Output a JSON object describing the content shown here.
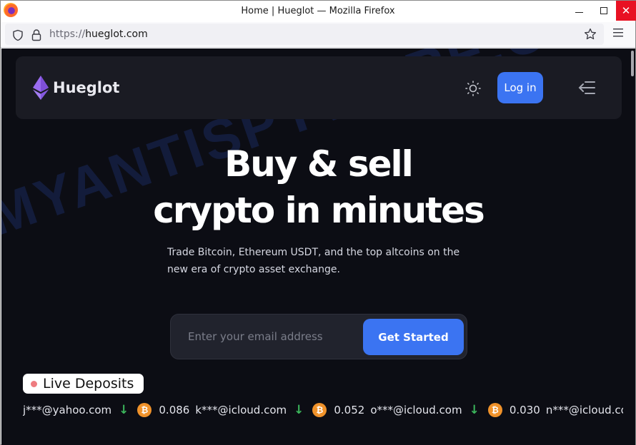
{
  "browser": {
    "window_title": "Home | Hueglot — Mozilla Firefox",
    "url_protocol": "https://",
    "url_host": "hueglot.com",
    "close_glyph": "✕"
  },
  "header": {
    "brand_name": "Hueglot",
    "login_label": "Log in"
  },
  "hero": {
    "title_line1": "Buy & sell",
    "title_line2": "crypto in minutes",
    "subtitle": "Trade Bitcoin, Ethereum USDT, and the top altcoins on the new era of crypto asset exchange."
  },
  "signup": {
    "email_placeholder": "Enter your email address",
    "email_value": "",
    "cta_label": "Get Started"
  },
  "live_deposits": {
    "label": "Live Deposits",
    "items": [
      {
        "email": "j***@yahoo.com",
        "direction": "↓",
        "coin_glyph": "₿",
        "amount": "0.086"
      },
      {
        "email": "k***@icloud.com",
        "direction": "↓",
        "coin_glyph": "₿",
        "amount": "0.052"
      },
      {
        "email": "o***@icloud.com",
        "direction": "↓",
        "coin_glyph": "₿",
        "amount": "0.030"
      },
      {
        "email": "n***@icloud.com",
        "direction": "↓",
        "coin_glyph": "₿",
        "amount": ""
      }
    ]
  },
  "watermark": "MYANTISPYWARE.COM",
  "colors": {
    "accent": "#3b74f2",
    "page_bg": "#0c0d14",
    "header_bg": "#1a1b23",
    "deposit_arrow": "#3bb55b",
    "bitcoin": "#f0922a",
    "live_dot": "#ee7c80"
  }
}
